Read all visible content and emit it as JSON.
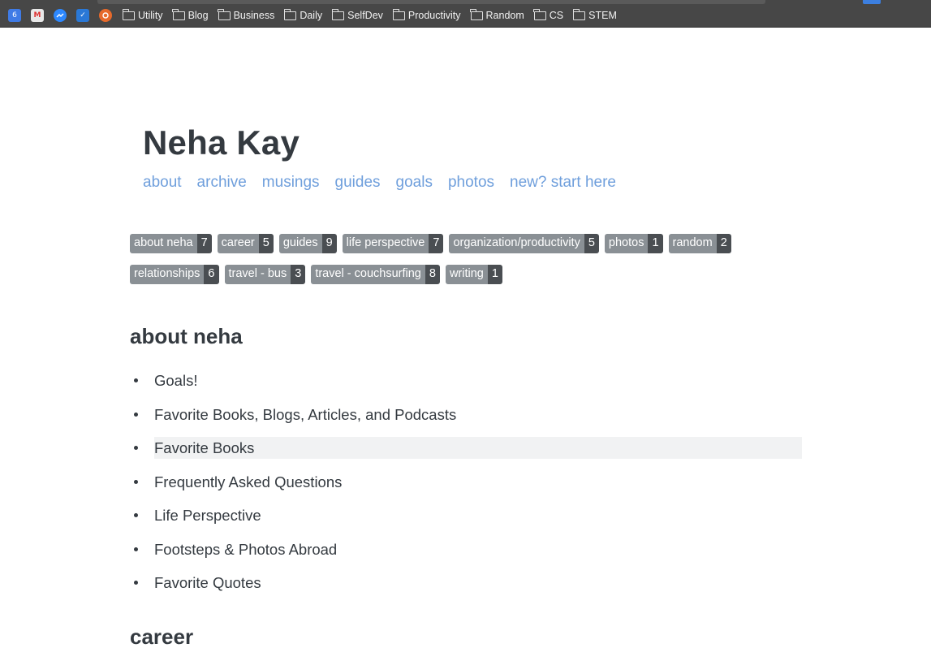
{
  "browser": {
    "bookmark_icons": [
      {
        "name": "google-calendar-icon",
        "label": "6"
      },
      {
        "name": "gmail-icon",
        "label": "M"
      },
      {
        "name": "messenger-icon",
        "label": ""
      },
      {
        "name": "tasks-check-icon",
        "label": "✓"
      },
      {
        "name": "orange-app-icon",
        "label": ""
      }
    ],
    "bookmark_folders": [
      "Utility",
      "Blog",
      "Business",
      "Daily",
      "SelfDev",
      "Productivity",
      "Random",
      "CS",
      "STEM"
    ]
  },
  "site": {
    "title": "Neha Kay",
    "nav": [
      "about",
      "archive",
      "musings",
      "guides",
      "goals",
      "photos",
      "new? start here"
    ]
  },
  "tags": {
    "row1": [
      {
        "name": "about neha",
        "count": "7"
      },
      {
        "name": "career",
        "count": "5"
      },
      {
        "name": "guides",
        "count": "9"
      },
      {
        "name": "life perspective",
        "count": "7"
      },
      {
        "name": "organization/productivity",
        "count": "5"
      },
      {
        "name": "photos",
        "count": "1"
      },
      {
        "name": "random",
        "count": "2"
      }
    ],
    "row2": [
      {
        "name": "relationships",
        "count": "6"
      },
      {
        "name": "travel - bus",
        "count": "3"
      },
      {
        "name": "travel - couchsurfing",
        "count": "8"
      },
      {
        "name": "writing",
        "count": "1"
      }
    ]
  },
  "sections": {
    "about_neha": {
      "heading": "about neha",
      "posts": [
        "Goals!",
        "Favorite Books, Blogs, Articles, and Podcasts",
        "Favorite Books",
        "Frequently Asked Questions",
        "Life Perspective",
        "Footsteps & Photos Abroad",
        "Favorite Quotes"
      ]
    },
    "career": {
      "heading": "career"
    }
  }
}
